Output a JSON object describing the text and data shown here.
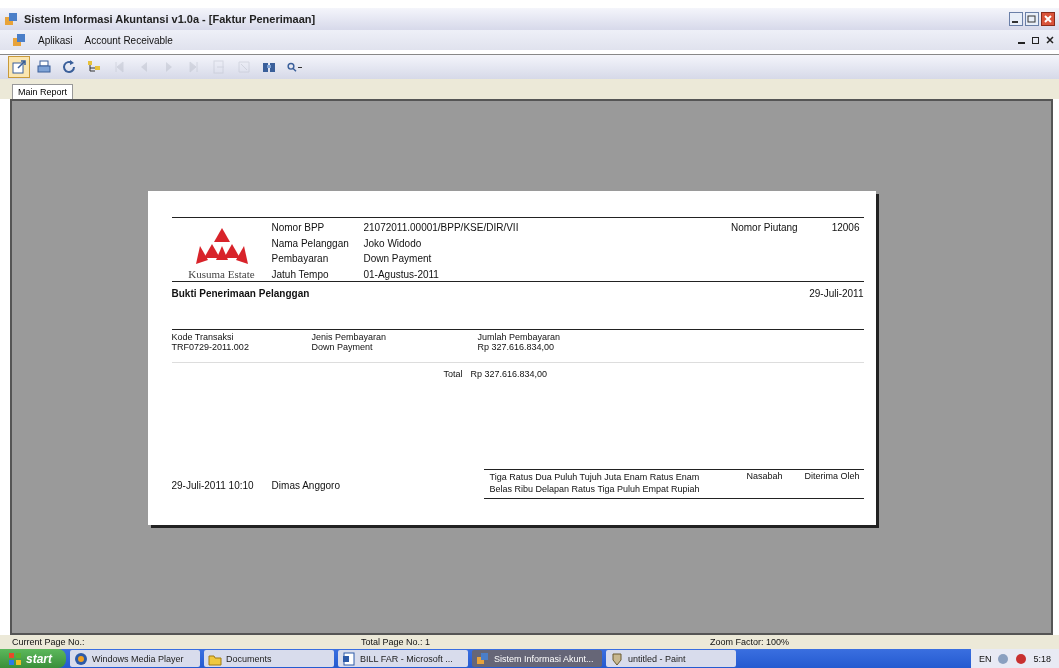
{
  "window": {
    "title": "Sistem Informasi Akuntansi v1.0a - [Faktur Penerimaan]"
  },
  "menu": [
    "Aplikasi",
    "Account Receivable"
  ],
  "toolbar": [
    {
      "kind": "export",
      "disabled": false,
      "selected": true
    },
    {
      "kind": "print",
      "disabled": false,
      "selected": false
    },
    {
      "kind": "refresh",
      "disabled": false,
      "selected": false
    },
    {
      "kind": "tree",
      "disabled": false,
      "selected": false
    },
    {
      "kind": "first",
      "disabled": true,
      "selected": false
    },
    {
      "kind": "prev",
      "disabled": true,
      "selected": false
    },
    {
      "kind": "next",
      "disabled": true,
      "selected": false
    },
    {
      "kind": "last",
      "disabled": true,
      "selected": false
    },
    {
      "kind": "goto",
      "disabled": true,
      "selected": false
    },
    {
      "kind": "stop",
      "disabled": true,
      "selected": false
    },
    {
      "kind": "search",
      "disabled": false,
      "selected": false
    },
    {
      "kind": "zoom",
      "disabled": false,
      "selected": false
    }
  ],
  "tabs": [
    {
      "label": "Main Report",
      "selected": true
    }
  ],
  "report": {
    "logo_text": "Kusuma Estate",
    "fields": [
      {
        "label": "Nomor BPP",
        "value": "21072011.00001/BPP/KSE/DIR/VII"
      },
      {
        "label": "Nama Pelanggan",
        "value": "Joko Widodo"
      },
      {
        "label": "Pembayaran",
        "value": "Down Payment"
      },
      {
        "label": "Jatuh Tempo",
        "value": "01-Agustus-2011"
      }
    ],
    "ref_label": "Nomor Piutang",
    "ref_value": "12006",
    "heading": "Bukti Penerimaan Pelanggan",
    "date": "29-Juli-2011",
    "columns": [
      "Kode Transaksi",
      "Jenis Pembayaran",
      "Jumlah Pembayaran"
    ],
    "rows": [
      [
        "TRF0729-2011.002",
        "Down Payment",
        "Rp 327.616.834,00"
      ]
    ],
    "total_label": "Total",
    "total_value": "Rp 327.616.834,00",
    "amount_words": "Tiga Ratus Dua Puluh Tujuh Juta Enam Ratus Enam Belas Ribu Delapan Ratus Tiga Puluh Empat Rupiah",
    "signatures": [
      "Nasabah",
      "Diterima Oleh"
    ],
    "printed_at": "29-Juli-2011 10:10",
    "printed_by": "Dimas Anggoro"
  },
  "status_bar": [
    "Current Page No.:",
    "Total Page No.: 1",
    "Zoom Factor: 100%"
  ],
  "taskbar": {
    "start": "start",
    "items": [
      {
        "label": "Windows Media Player",
        "kind": "media",
        "selected": false
      },
      {
        "label": "Documents",
        "kind": "folder",
        "selected": false
      },
      {
        "label": "BILL FAR - Microsoft ...",
        "kind": "doc",
        "selected": false
      },
      {
        "label": "Sistem Informasi Akunt...",
        "kind": "app",
        "selected": true
      },
      {
        "label": "untitled - Paint",
        "kind": "paint",
        "selected": false
      }
    ],
    "tray": [
      "EN",
      "5:18"
    ]
  }
}
